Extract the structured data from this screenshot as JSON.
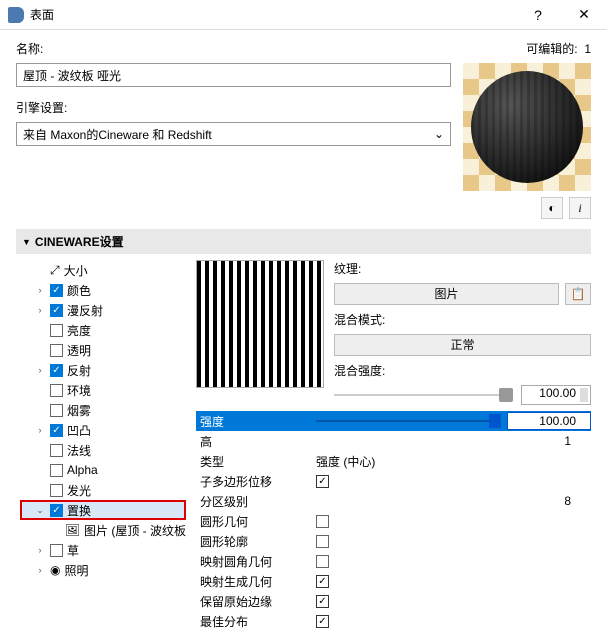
{
  "titlebar": {
    "title": "表面",
    "help": "?",
    "close": "✕"
  },
  "header": {
    "name_label": "名称:",
    "editable_label": "可编辑的:",
    "editable_count": "1"
  },
  "name_value": "屋顶 - 波纹板 哑光",
  "engine": {
    "label": "引擎设置:",
    "value": "来自 Maxon的Cineware 和 Redshift"
  },
  "info_icon": "i",
  "panel_title": "CINEWARE设置",
  "tree": [
    {
      "expand": "",
      "checked": false,
      "label": "大小",
      "icon": "⤢"
    },
    {
      "expand": "›",
      "checked": true,
      "label": "颜色"
    },
    {
      "expand": "›",
      "checked": true,
      "label": "漫反射"
    },
    {
      "expand": "",
      "checked": false,
      "label": "亮度"
    },
    {
      "expand": "",
      "checked": false,
      "label": "透明"
    },
    {
      "expand": "›",
      "checked": true,
      "label": "反射"
    },
    {
      "expand": "",
      "checked": false,
      "label": "环境"
    },
    {
      "expand": "",
      "checked": false,
      "label": "烟雾"
    },
    {
      "expand": "›",
      "checked": true,
      "label": "凹凸"
    },
    {
      "expand": "",
      "checked": false,
      "label": "法线"
    },
    {
      "expand": "",
      "checked": false,
      "label": "Alpha"
    },
    {
      "expand": "",
      "checked": false,
      "label": "发光"
    },
    {
      "expand": "⌄",
      "checked": true,
      "label": "置换",
      "selected": true,
      "redbox": true
    },
    {
      "expand": "",
      "checked": false,
      "label": "图片 (屋顶 - 波纹板",
      "indent": true,
      "icon": "🖼"
    },
    {
      "expand": "›",
      "checked": false,
      "label": "草"
    },
    {
      "expand": "›",
      "checked": false,
      "label": "照明",
      "icon": "◉"
    }
  ],
  "props": {
    "texture_label": "纹理:",
    "texture_btn": "图片",
    "blend_label": "混合模式:",
    "blend_btn": "正常",
    "blend_strength_label": "混合强度:",
    "blend_strength_val": "100.00",
    "list": [
      {
        "name": "强度",
        "type": "slider",
        "value": "100.00",
        "selected": true
      },
      {
        "name": "高",
        "type": "num",
        "value": "1"
      },
      {
        "name": "类型",
        "type": "text",
        "value": "强度 (中心)"
      },
      {
        "name": "子多边形位移",
        "type": "check",
        "checked": true
      },
      {
        "name": "分区级别",
        "type": "num",
        "value": "8"
      },
      {
        "name": "圆形几何",
        "type": "check",
        "checked": false
      },
      {
        "name": "圆形轮廓",
        "type": "check",
        "checked": false
      },
      {
        "name": "映射圆角几何",
        "type": "check",
        "checked": false
      },
      {
        "name": "映射生成几何",
        "type": "check",
        "checked": true
      },
      {
        "name": "保留原始边缘",
        "type": "check",
        "checked": true
      },
      {
        "name": "最佳分布",
        "type": "check",
        "checked": true
      }
    ]
  }
}
